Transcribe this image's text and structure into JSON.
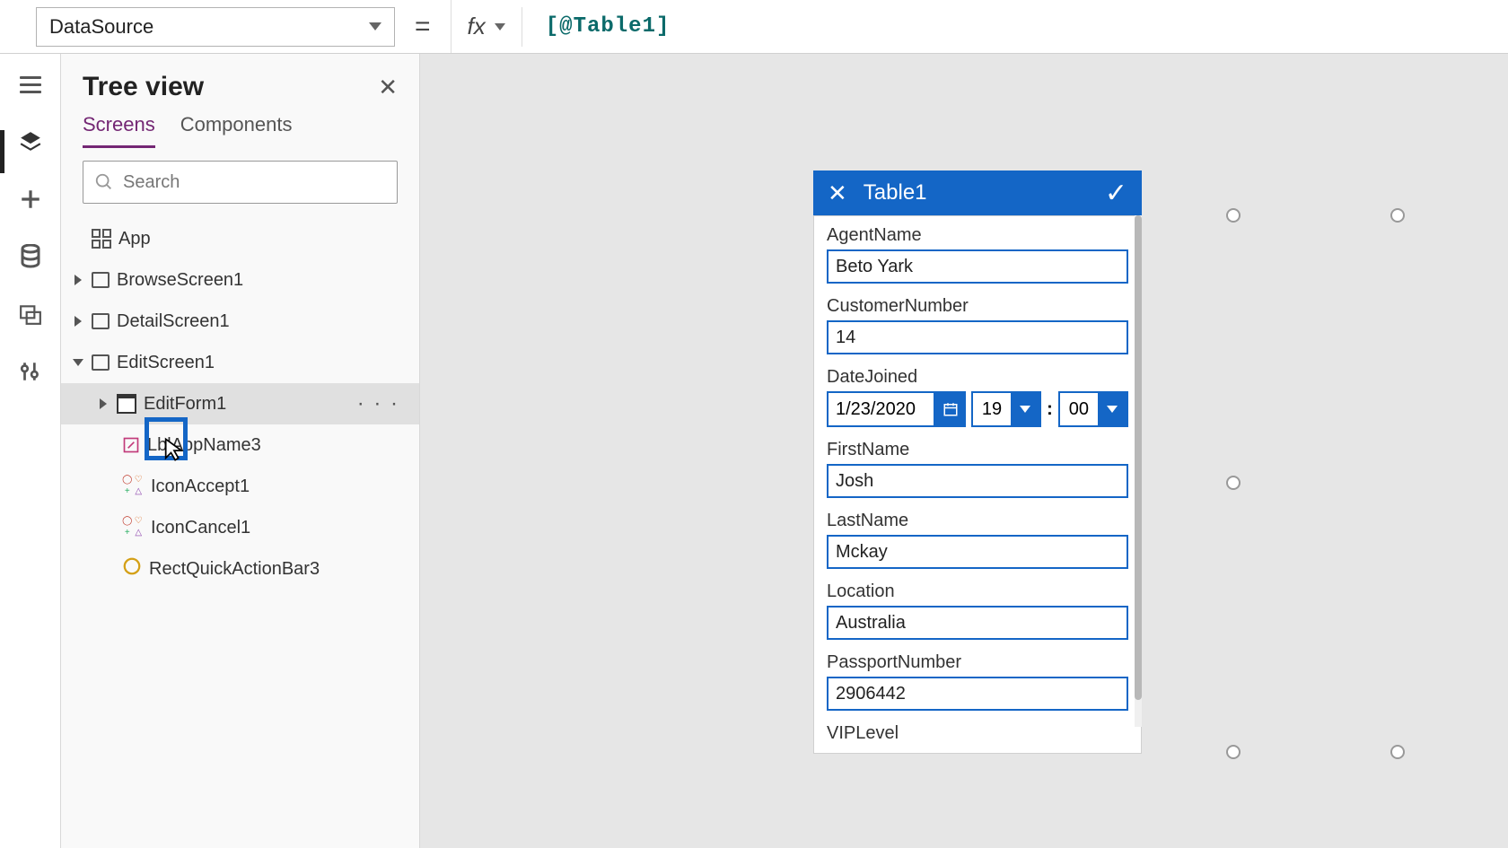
{
  "formulaBar": {
    "property": "DataSource",
    "fxLabel": "fx",
    "value": "[@Table1]"
  },
  "treePanel": {
    "title": "Tree view",
    "tabs": {
      "screens": "Screens",
      "components": "Components"
    },
    "searchPlaceholder": "Search",
    "items": {
      "app": "App",
      "browse": "BrowseScreen1",
      "detail": "DetailScreen1",
      "editScreen": "EditScreen1",
      "editForm": "EditForm1",
      "lblApp": "LblAppName3",
      "iconAccept": "IconAccept1",
      "iconCancel": "IconCancel1",
      "rectQuick": "RectQuickActionBar3"
    },
    "moreDots": "· · ·"
  },
  "mobile": {
    "headerTitle": "Table1",
    "fields": {
      "agentName": {
        "label": "AgentName",
        "value": "Beto Yark"
      },
      "customerNumber": {
        "label": "CustomerNumber",
        "value": "14"
      },
      "dateJoined": {
        "label": "DateJoined",
        "date": "1/23/2020",
        "hour": "19",
        "minute": "00"
      },
      "firstName": {
        "label": "FirstName",
        "value": "Josh"
      },
      "lastName": {
        "label": "LastName",
        "value": "Mckay"
      },
      "location": {
        "label": "Location",
        "value": "Australia"
      },
      "passportNumber": {
        "label": "PassportNumber",
        "value": "2906442"
      },
      "vipLevel": {
        "label": "VIPLevel"
      }
    }
  }
}
